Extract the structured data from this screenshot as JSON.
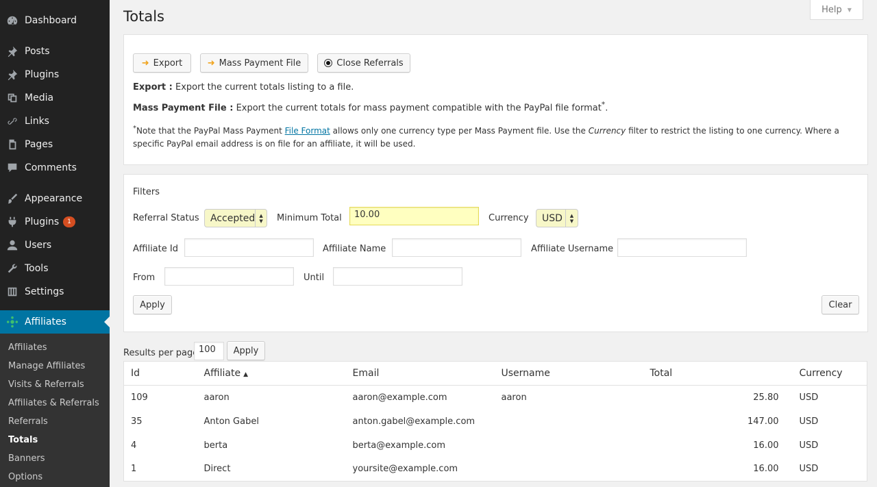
{
  "sidebar": {
    "items": [
      {
        "label": "Dashboard",
        "icon": "dashboard-icon"
      },
      {
        "label": "Posts",
        "icon": "pin-icon"
      },
      {
        "label": "Plugins",
        "icon": "pin-icon"
      },
      {
        "label": "Media",
        "icon": "media-icon"
      },
      {
        "label": "Links",
        "icon": "link-icon"
      },
      {
        "label": "Pages",
        "icon": "page-icon"
      },
      {
        "label": "Comments",
        "icon": "comment-icon"
      },
      {
        "label": "Appearance",
        "icon": "brush-icon"
      },
      {
        "label": "Plugins",
        "icon": "plug-icon",
        "badge": "1"
      },
      {
        "label": "Users",
        "icon": "user-icon"
      },
      {
        "label": "Tools",
        "icon": "wrench-icon"
      },
      {
        "label": "Settings",
        "icon": "settings-icon"
      },
      {
        "label": "Affiliates",
        "icon": "affiliates-icon"
      }
    ],
    "submenu": [
      "Affiliates",
      "Manage Affiliates",
      "Visits & Referrals",
      "Affiliates & Referrals",
      "Referrals",
      "Totals",
      "Banners",
      "Options"
    ],
    "current_submenu": "Totals"
  },
  "page": {
    "title": "Totals",
    "help_label": "Help"
  },
  "actions": {
    "export_label": "Export",
    "mass_payment_label": "Mass Payment File",
    "close_referrals_label": "Close Referrals",
    "export_desc_title": "Export :",
    "export_desc": " Export the current totals listing to a file.",
    "mass_desc_title": "Mass Payment File :",
    "mass_desc": " Export the current totals for mass payment compatible with the PayPal file format",
    "mass_desc_sup": "*",
    "mass_desc_end": ".",
    "note_sup": "*",
    "note_1": "Note that the PayPal Mass Payment ",
    "note_link": "File Format",
    "note_2": " allows only one currency type per Mass Payment file. Use the ",
    "note_italic": "Currency",
    "note_3": " filter to restrict the listing to one currency. Where a specific PayPal email address is on file for an affiliate, it will be used."
  },
  "filters": {
    "title": "Filters",
    "referral_status_label": "Referral Status",
    "referral_status_value": "Accepted",
    "minimum_total_label": "Minimum Total",
    "minimum_total_value": "10.00",
    "currency_label": "Currency",
    "currency_value": "USD",
    "affiliate_id_label": "Affiliate Id",
    "affiliate_name_label": "Affiliate Name",
    "affiliate_username_label": "Affiliate Username",
    "from_label": "From",
    "until_label": "Until",
    "apply_label": "Apply",
    "clear_label": "Clear"
  },
  "results": {
    "per_page_label": "Results per page",
    "per_page_value": "100",
    "apply_label": "Apply",
    "columns": [
      "Id",
      "Affiliate",
      "Email",
      "Username",
      "Total",
      "Currency"
    ],
    "sorted_column": "Affiliate",
    "rows": [
      {
        "id": "109",
        "affiliate": "aaron",
        "email": "aaron@example.com",
        "username": "aaron",
        "total": "25.80",
        "currency": "USD"
      },
      {
        "id": "35",
        "affiliate": "Anton Gabel",
        "email": "anton.gabel@example.com",
        "username": "",
        "total": "147.00",
        "currency": "USD"
      },
      {
        "id": "4",
        "affiliate": "berta",
        "email": "berta@example.com",
        "username": "",
        "total": "16.00",
        "currency": "USD"
      },
      {
        "id": "1",
        "affiliate": "Direct",
        "email": "yoursite@example.com",
        "username": "",
        "total": "16.00",
        "currency": "USD"
      }
    ]
  },
  "colors": {
    "sidebar_bg": "#222222",
    "active_bg": "#0074a2",
    "badge_bg": "#d54e21",
    "highlight_field": "#ffffc0"
  }
}
